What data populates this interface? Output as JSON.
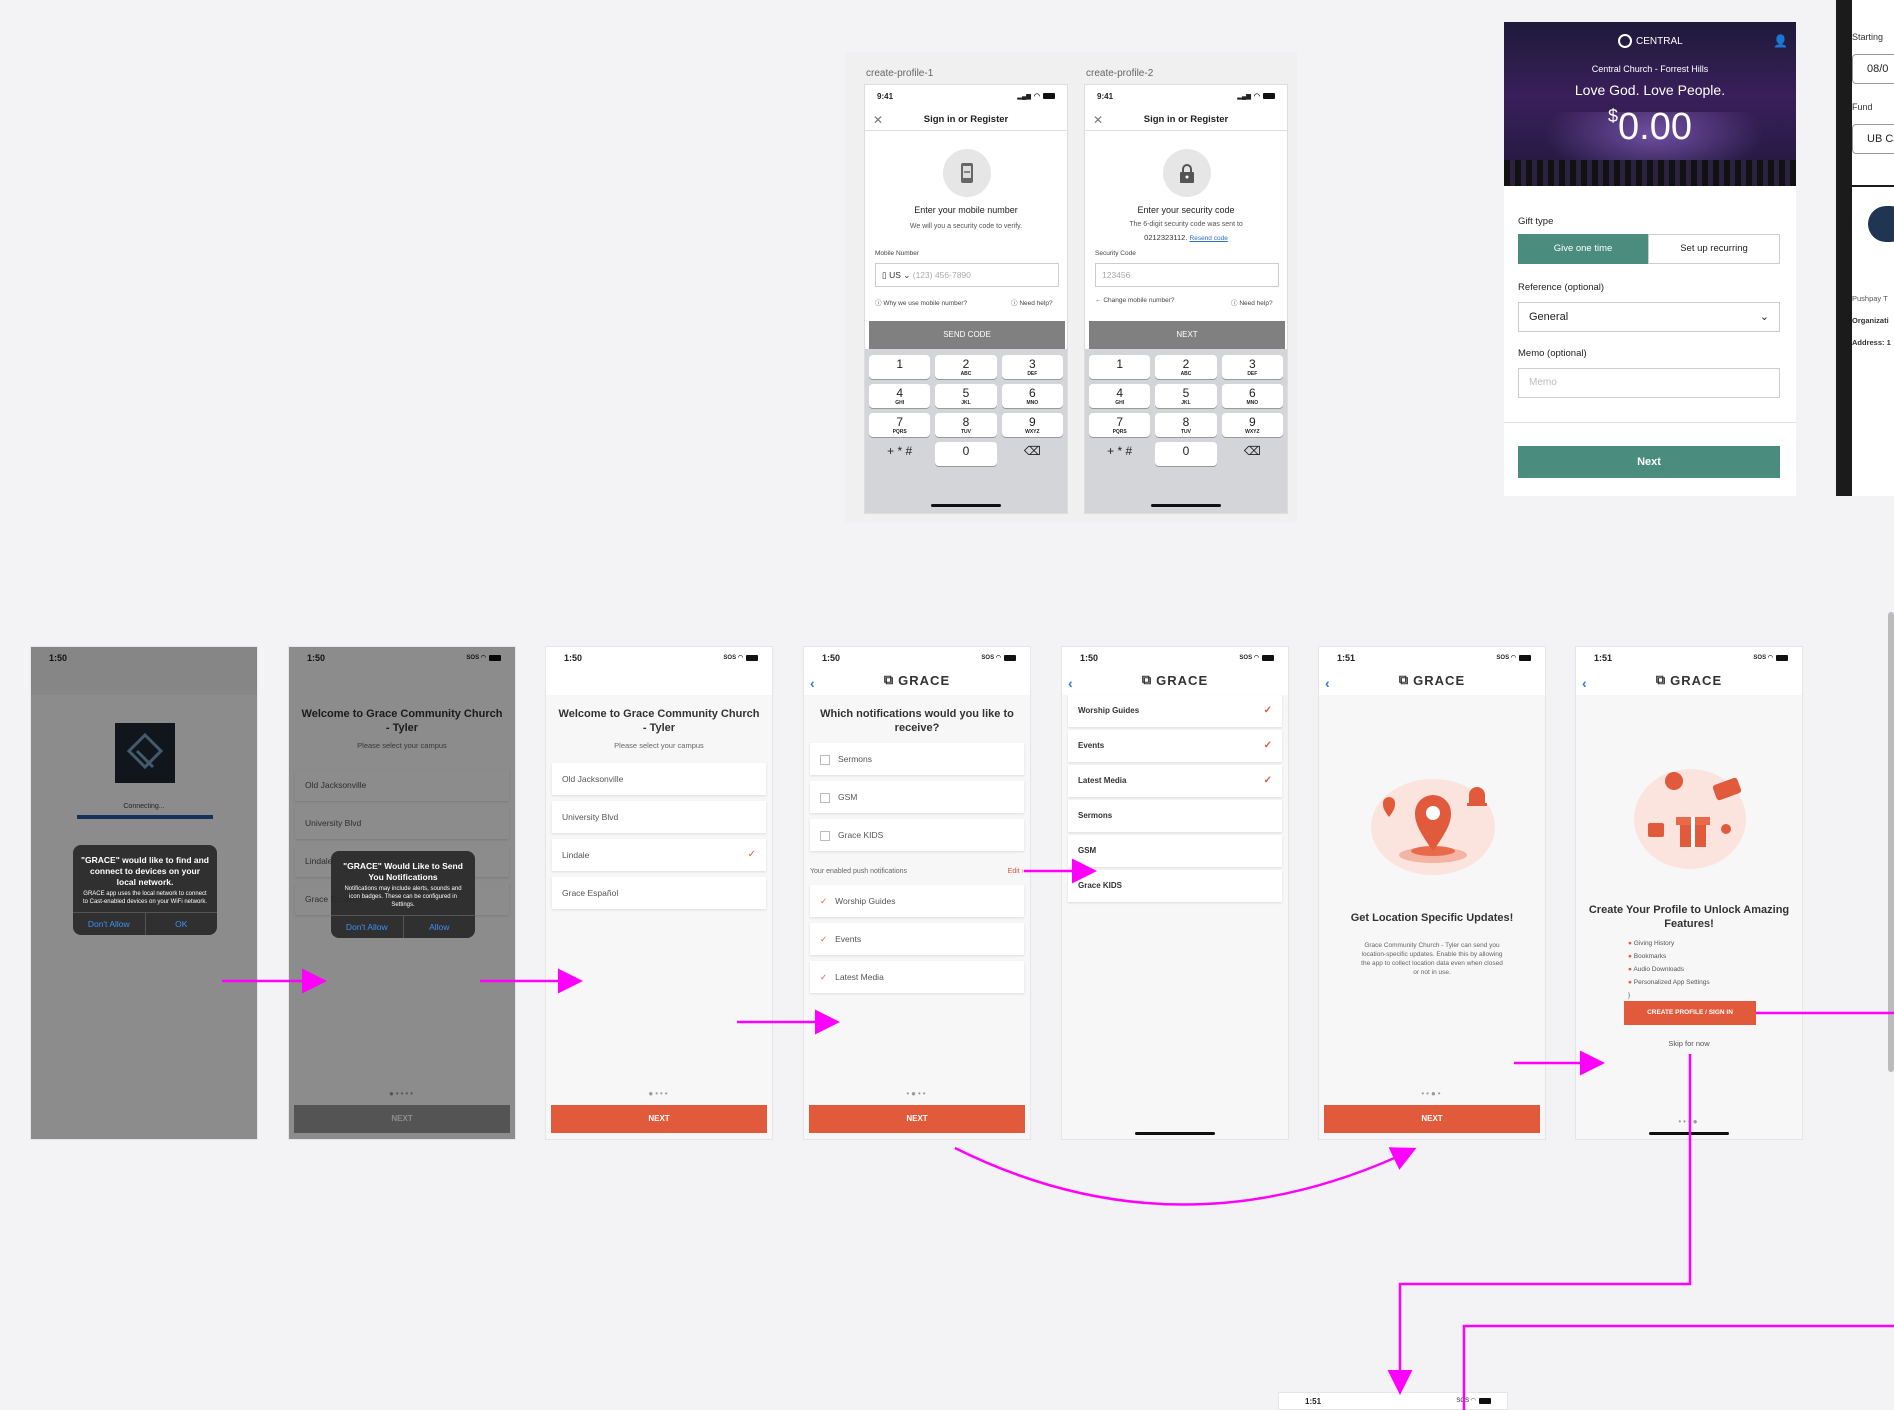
{
  "frames": {
    "profile1": "create-profile-1",
    "profile2": "create-profile-2"
  },
  "cp1": {
    "time": "9:41",
    "title": "Sign in or Register",
    "heading": "Enter your mobile number",
    "sub": "We will you a security code to verify.",
    "field_label": "Mobile Number",
    "country": "US",
    "placeholder": "(123) 456-7890",
    "why": "Why we use mobile number?",
    "help": "Need help?",
    "button": "SEND CODE"
  },
  "cp2": {
    "time": "9:41",
    "title": "Sign in or Register",
    "heading": "Enter your security code",
    "sub": "The 6-digit security code was sent to",
    "phone": "0212323112.",
    "resend": "Resend code",
    "field_label": "Security Code",
    "placeholder": "123456",
    "change": "Change mobile number?",
    "help": "Need help?",
    "button": "NEXT"
  },
  "keypad": [
    {
      "n": "1",
      "l": ""
    },
    {
      "n": "2",
      "l": "ABC"
    },
    {
      "n": "3",
      "l": "DEF"
    },
    {
      "n": "4",
      "l": "GHI"
    },
    {
      "n": "5",
      "l": "JKL"
    },
    {
      "n": "6",
      "l": "MNO"
    },
    {
      "n": "7",
      "l": "PQRS"
    },
    {
      "n": "8",
      "l": "TUV"
    },
    {
      "n": "9",
      "l": "WXYZ"
    },
    {
      "n": "+ * #",
      "l": ""
    },
    {
      "n": "0",
      "l": ""
    },
    {
      "n": "⌫",
      "l": ""
    }
  ],
  "give": {
    "brand": "CENTRAL",
    "church": "Central Church - Forrest Hills",
    "tagline": "Love God. Love People.",
    "currency": "$",
    "amount": "0.00",
    "gift_type_label": "Gift type",
    "one_time": "Give one time",
    "recurring": "Set up recurring",
    "reference_label": "Reference (optional)",
    "reference_value": "General",
    "memo_label": "Memo (optional)",
    "memo_placeholder": "Memo",
    "next": "Next"
  },
  "side": {
    "starting": "Starting",
    "date": "08/0",
    "fund": "Fund",
    "fund_value": "UB Ca",
    "pushpay": "Pushpay T",
    "org": "Organizati",
    "address": "Address: 1"
  },
  "s1": {
    "time": "1:50",
    "connecting": "Connecting...",
    "alert_title": "\"GRACE\" would like to find and connect to devices on your local network.",
    "alert_body": "GRACE app uses the local network to connect to Cast-enabled devices on your WiFi network.",
    "deny": "Don't Allow",
    "ok": "OK"
  },
  "s2": {
    "time": "1:50",
    "title": "Welcome to Grace Community Church - Tyler",
    "sub": "Please select your campus",
    "items": [
      "Old Jacksonville",
      "University Blvd",
      "Lindale",
      "Grace Español"
    ],
    "alert_title": "\"GRACE\" Would Like to Send You Notifications",
    "alert_body": "Notifications may include alerts, sounds and icon badges. These can be configured in Settings.",
    "deny": "Don't Allow",
    "allow": "Allow",
    "next": "NEXT"
  },
  "s3": {
    "time": "1:50",
    "title": "Welcome to Grace Community Church - Tyler",
    "sub": "Please select your campus",
    "items": [
      "Old Jacksonville",
      "University Blvd",
      "Lindale",
      "Grace Español"
    ],
    "next": "NEXT"
  },
  "s4": {
    "time": "1:50",
    "brand": "GRACE",
    "title": "Which notifications would you like to receive?",
    "options": [
      "Sermons",
      "GSM",
      "Grace KIDS"
    ],
    "enabled_label": "Your enabled push notifications",
    "edit": "Edit",
    "enabled": [
      "Worship Guides",
      "Events",
      "Latest Media"
    ],
    "next": "NEXT"
  },
  "s5": {
    "time": "1:50",
    "brand": "GRACE",
    "items": [
      "Worship Guides",
      "Events",
      "Latest Media",
      "Sermons",
      "GSM",
      "Grace KIDS"
    ],
    "checked": [
      true,
      true,
      true,
      false,
      false,
      false
    ]
  },
  "s6": {
    "time": "1:51",
    "brand": "GRACE",
    "title": "Get Location Specific Updates!",
    "body": "Grace Community Church - Tyler can send you location-specific updates. Enable this by allowing the app to collect location data even when closed or not in use.",
    "next": "NEXT"
  },
  "s7": {
    "time": "1:51",
    "brand": "GRACE",
    "title": "Create Your Profile to Unlock Amazing Features!",
    "features": [
      "Giving History",
      "Bookmarks",
      "Audio Downloads",
      "Personalized App Settings"
    ],
    "cta": "CREATE PROFILE / SIGN IN",
    "skip": "Skip for now"
  },
  "s8": {
    "time": "1:51"
  },
  "colors": {
    "accent": "#e05a3b",
    "teal": "#4a8c7d",
    "flow": "#ff00ff",
    "ios_blue": "#2b7ae4"
  }
}
